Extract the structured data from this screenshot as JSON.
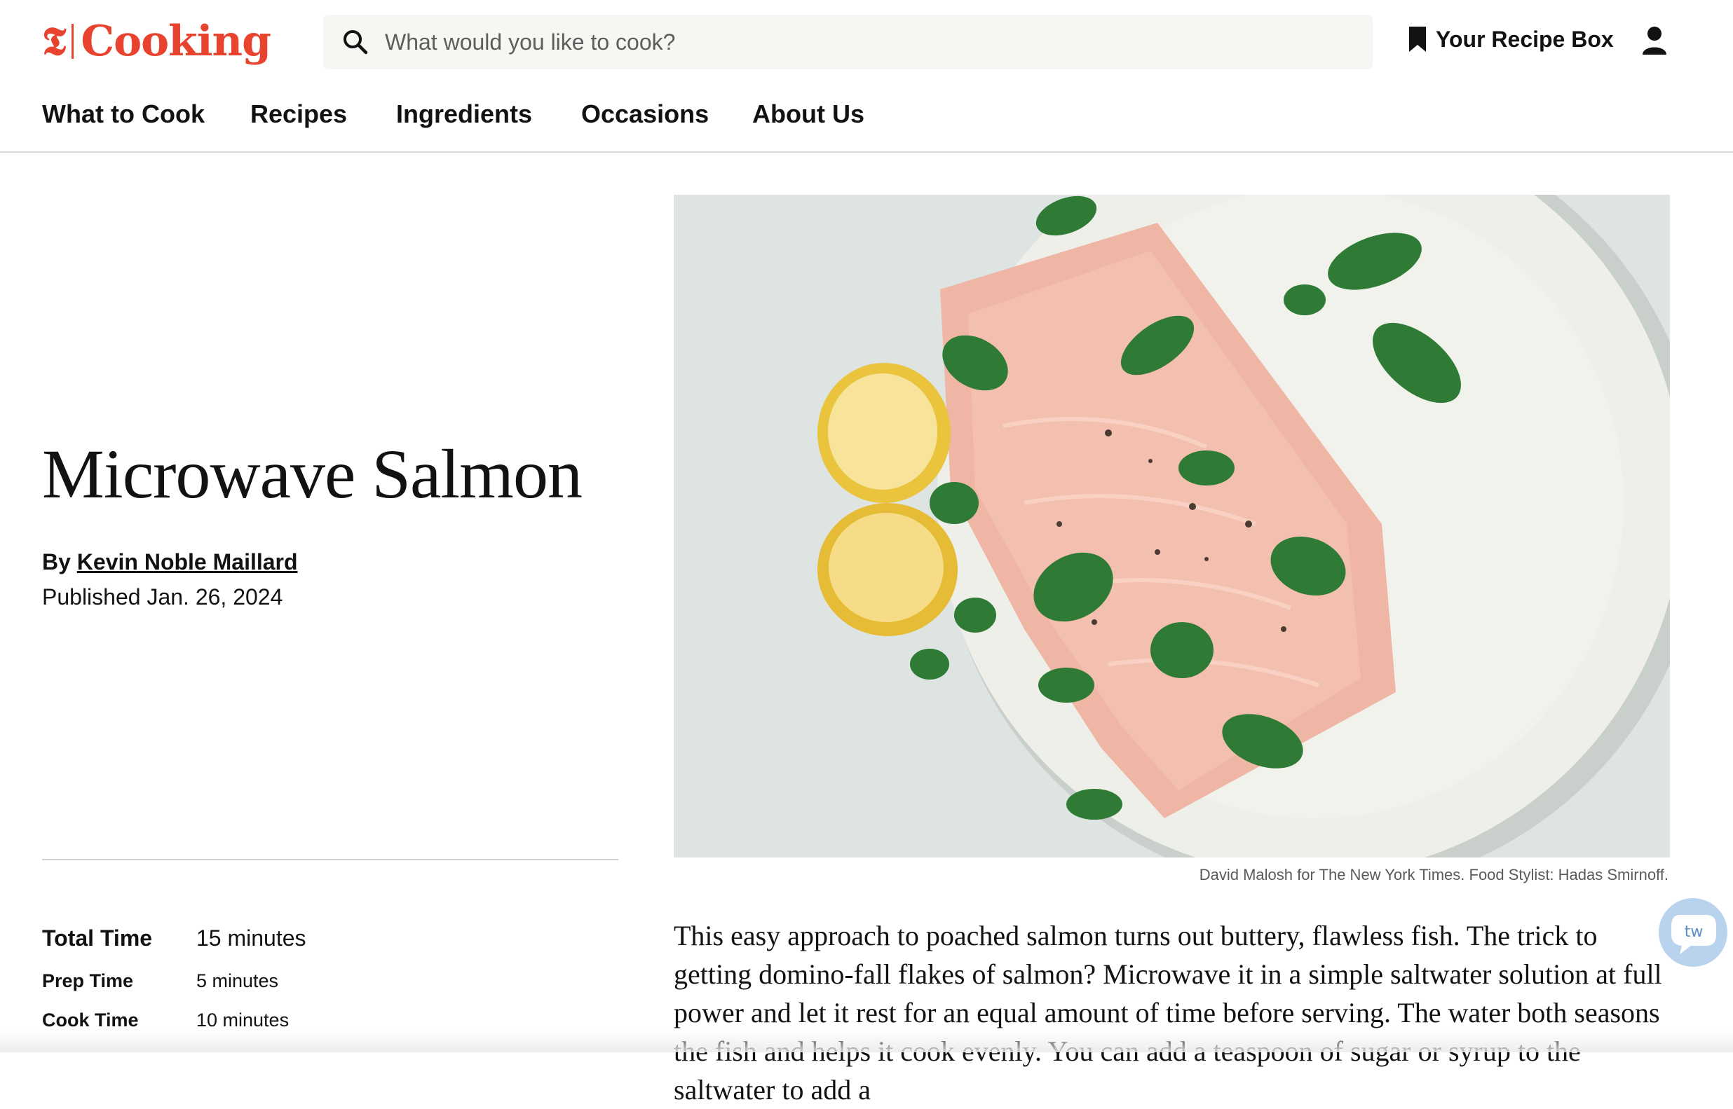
{
  "header": {
    "logo_t": "𝕿",
    "logo_word": "Cooking",
    "search_placeholder": "What would you like to cook?",
    "recipe_box_label": "Your Recipe Box",
    "icons": [
      "search-icon",
      "bookmark-icon",
      "account-icon"
    ]
  },
  "nav": {
    "items": [
      "What to Cook",
      "Recipes",
      "Ingredients",
      "Occasions",
      "About Us"
    ]
  },
  "recipe": {
    "title": "Microwave Salmon",
    "byline_prefix": "By",
    "author": "Kevin Noble Maillard",
    "published": "Published Jan. 26, 2024",
    "times": [
      {
        "label": "Total Time",
        "value": "15 minutes"
      },
      {
        "label": "Prep Time",
        "value": "5 minutes"
      },
      {
        "label": "Cook Time",
        "value": "10 minutes"
      }
    ],
    "photo_credit": "David Malosh for The New York Times. Food Stylist: Hadas Smirnoff.",
    "intro": "This easy approach to poached salmon turns out buttery, flawless fish. The trick to getting domino-fall flakes of salmon? Microwave it in a simple saltwater solution at full power and let it rest for an equal amount of time before serving. The water both seasons the fish and helps it cook evenly. You can add a teaspoon of sugar or syrup to the saltwater to add a"
  },
  "chat_widget": {
    "label": "tw"
  },
  "colors": {
    "brand": "#e8432e",
    "text": "#121212",
    "search_bg": "#f6f6f3",
    "chat_bg": "#b9d3ee"
  }
}
